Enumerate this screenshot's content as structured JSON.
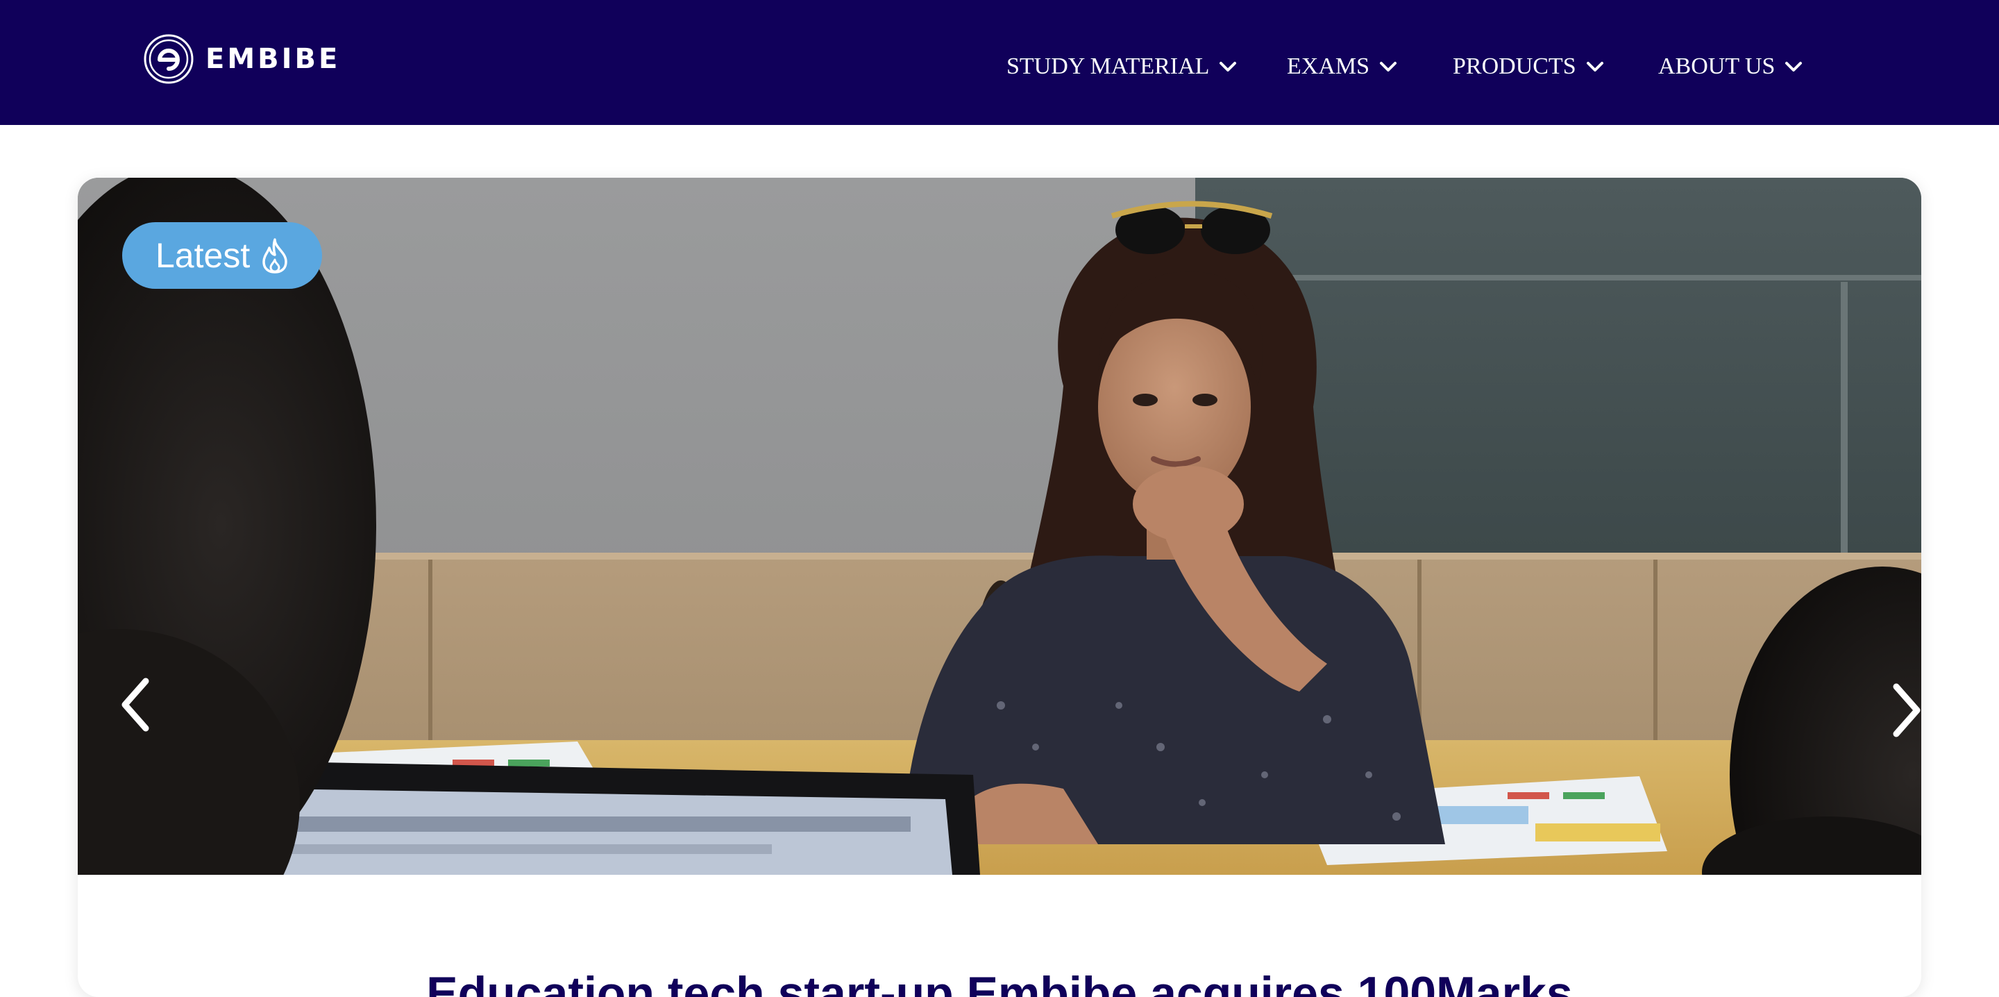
{
  "brand": {
    "name": "EMBIBE",
    "color_primary": "#10005a",
    "color_accent": "#5aa7e0"
  },
  "nav": {
    "items": [
      {
        "label": "STUDY MATERIAL",
        "icon": "chevron-down-icon"
      },
      {
        "label": "EXAMS",
        "icon": "chevron-down-icon"
      },
      {
        "label": "PRODUCTS",
        "icon": "chevron-down-icon"
      },
      {
        "label": "ABOUT US",
        "icon": "chevron-down-icon"
      }
    ]
  },
  "carousel": {
    "badge_label": "Latest",
    "badge_icon": "flame-icon",
    "prev_icon": "chevron-left-icon",
    "next_icon": "chevron-right-icon",
    "slide": {
      "headline": "Education tech start-up Embibe acquires 100Marks"
    }
  }
}
